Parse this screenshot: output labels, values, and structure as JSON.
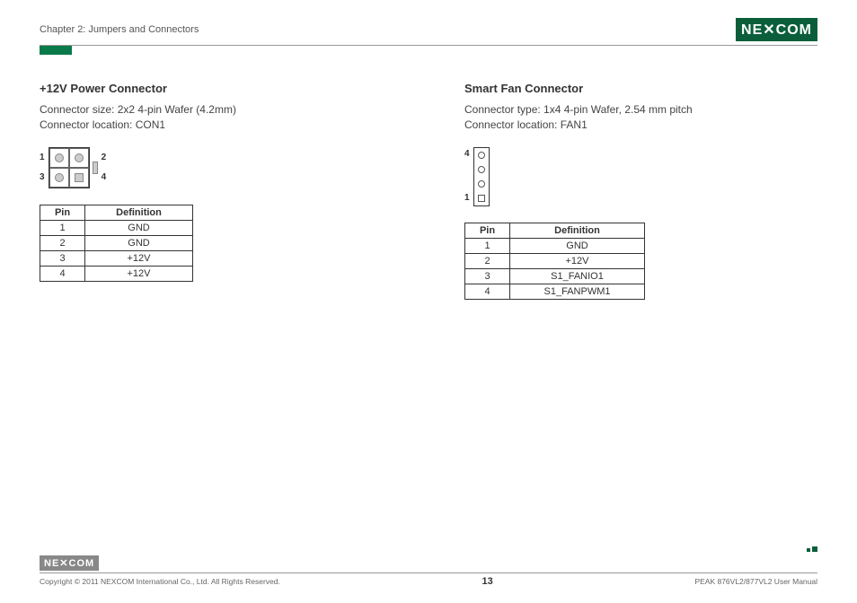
{
  "header": {
    "chapter": "Chapter 2: Jumpers and Connectors",
    "logo_text": "NE✕COM"
  },
  "left": {
    "title": "+12V Power Connector",
    "desc_line1": "Connector size:  2x2 4-pin Wafer (4.2mm)",
    "desc_line2": "Connector location: CON1",
    "labels": {
      "p1": "1",
      "p2": "2",
      "p3": "3",
      "p4": "4"
    },
    "table": {
      "headers": {
        "pin": "Pin",
        "def": "Definition"
      },
      "rows": [
        {
          "pin": "1",
          "def": "GND"
        },
        {
          "pin": "2",
          "def": "GND"
        },
        {
          "pin": "3",
          "def": "+12V"
        },
        {
          "pin": "4",
          "def": "+12V"
        }
      ]
    }
  },
  "right": {
    "title": "Smart Fan Connector",
    "desc_line1": "Connector type: 1x4 4-pin Wafer, 2.54 mm pitch",
    "desc_line2": "Connector location: FAN1",
    "labels": {
      "top": "4",
      "bottom": "1"
    },
    "table": {
      "headers": {
        "pin": "Pin",
        "def": "Definition"
      },
      "rows": [
        {
          "pin": "1",
          "def": "GND"
        },
        {
          "pin": "2",
          "def": "+12V"
        },
        {
          "pin": "3",
          "def": "S1_FANIO1"
        },
        {
          "pin": "4",
          "def": "S1_FANPWM1"
        }
      ]
    }
  },
  "footer": {
    "logo_text": "NE✕COM",
    "copyright": "Copyright © 2011 NEXCOM International Co., Ltd. All Rights Reserved.",
    "page": "13",
    "manual": "PEAK 876VL2/877VL2 User Manual"
  }
}
